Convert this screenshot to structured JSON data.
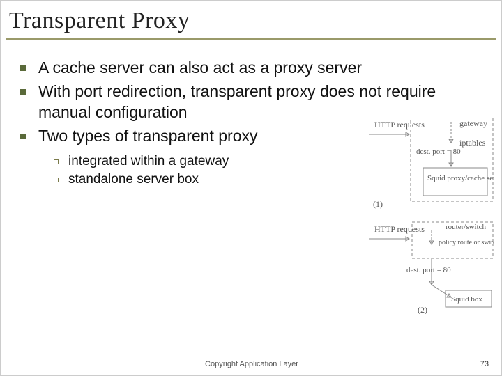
{
  "title": "Transparent Proxy",
  "bullets": [
    "A cache server can also act as a proxy server",
    "With port redirection, transparent proxy does not require manual configuration",
    "Two types of transparent proxy"
  ],
  "sub_bullets": [
    "integrated within a gateway",
    "standalone server box"
  ],
  "diagram": {
    "top": {
      "left_label": "HTTP requests",
      "right_label1": "gateway",
      "right_label2": "iptables",
      "rule": "dest. port = 80",
      "box": "Squid proxy/cache server",
      "index": "(1)"
    },
    "bottom": {
      "left_label": "HTTP requests",
      "right_label1": "router/switch",
      "right_label2": "policy route or switch rules",
      "rule": "dest. port = 80",
      "box": "Squid box",
      "index": "(2)"
    }
  },
  "footer": "Copyright Application Layer",
  "page": "73"
}
